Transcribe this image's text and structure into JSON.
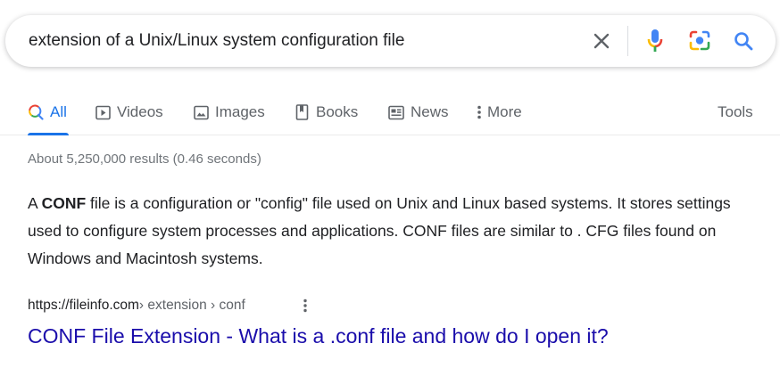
{
  "search": {
    "query": "extension of a Unix/Linux system configuration file"
  },
  "tabs": [
    {
      "label": "All",
      "icon": "search-icon",
      "active": true
    },
    {
      "label": "Videos",
      "icon": "video-icon"
    },
    {
      "label": "Images",
      "icon": "image-icon"
    },
    {
      "label": "Books",
      "icon": "book-icon"
    },
    {
      "label": "News",
      "icon": "news-icon"
    },
    {
      "label": "More",
      "icon": "more-vert-icon"
    }
  ],
  "tools_label": "Tools",
  "result_stats": "About 5,250,000 results (0.46 seconds)",
  "snippet": {
    "prefix": "A ",
    "bold": "CONF",
    "rest": " file is a configuration or \"config\" file used on Unix and Linux based systems. It stores settings used to configure system processes and applications. CONF files are similar to . CFG files found on Windows and Macintosh systems."
  },
  "result": {
    "domain": "https://fileinfo.com",
    "path": " › extension › conf",
    "title": "CONF File Extension - What is a .conf file and how do I open it?"
  },
  "colors": {
    "accent": "#1a73e8",
    "link": "#1a0dab",
    "text": "#202124",
    "muted": "#70757a"
  }
}
